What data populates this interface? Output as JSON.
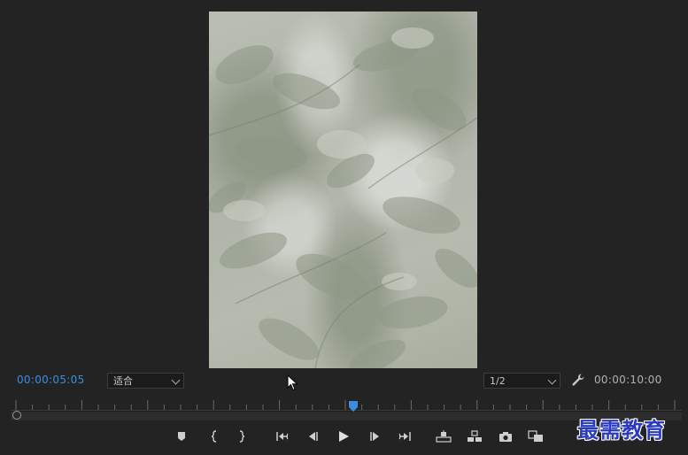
{
  "monitor": {
    "current_timecode": "00:00:05:05",
    "total_timecode": "00:00:10:00",
    "zoom_value": "适合",
    "resolution_value": "1/2"
  },
  "icons": {
    "settings": "wrench-icon",
    "add_marker": "marker-icon",
    "mark_in": "mark-in-icon",
    "mark_out": "mark-out-icon",
    "go_to_in": "go-to-in-icon",
    "step_back": "step-back-icon",
    "play": "play-icon",
    "step_forward": "step-forward-icon",
    "go_to_out": "go-to-out-icon",
    "lift": "lift-icon",
    "extract": "extract-icon",
    "export_frame": "camera-icon",
    "comparison_view": "comparison-view-icon"
  },
  "colors": {
    "background": "#232323",
    "timecode_active": "#3a8de0",
    "playhead": "#3a8de0",
    "watermark": "#2a3bbf"
  },
  "watermark": {
    "text": "最需教育"
  }
}
